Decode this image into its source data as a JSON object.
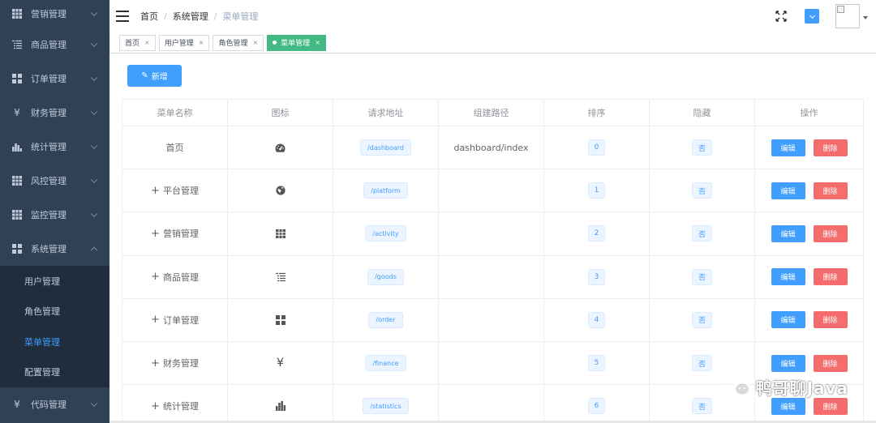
{
  "sidebar": {
    "items": [
      {
        "label": "营销管理",
        "icon": "grid-icon"
      },
      {
        "label": "商品管理",
        "icon": "list-icon"
      },
      {
        "label": "订单管理",
        "icon": "blocks-icon"
      },
      {
        "label": "财务管理",
        "icon": "yen-icon"
      },
      {
        "label": "统计管理",
        "icon": "bar-chart-icon"
      },
      {
        "label": "风控管理",
        "icon": "grid-icon"
      },
      {
        "label": "监控管理",
        "icon": "grid-icon"
      },
      {
        "label": "系统管理",
        "icon": "blocks-icon"
      }
    ],
    "submenu": [
      {
        "label": "用户管理"
      },
      {
        "label": "角色管理"
      },
      {
        "label": "菜单管理"
      },
      {
        "label": "配置管理"
      }
    ],
    "last_item": {
      "label": "代码管理",
      "icon": "yen-icon"
    }
  },
  "navbar": {
    "breadcrumb": [
      "首页",
      "系统管理",
      "菜单管理"
    ]
  },
  "tags": [
    {
      "label": "首页"
    },
    {
      "label": "用户管理"
    },
    {
      "label": "角色管理"
    },
    {
      "label": "菜单管理"
    }
  ],
  "toolbar": {
    "add_label": "新增"
  },
  "table": {
    "headers": [
      "菜单名称",
      "图标",
      "请求地址",
      "组建路径",
      "排序",
      "隐藏",
      "操作"
    ],
    "edit_label": "编辑",
    "delete_label": "删除",
    "rows": [
      {
        "name": "首页",
        "icon": "dashboard-icon",
        "path": "/dashboard",
        "component": "dashboard/index",
        "order": "0",
        "hidden": "否"
      },
      {
        "name": "平台管理",
        "icon": "globe-icon",
        "path": "/platform",
        "component": "",
        "order": "1",
        "hidden": "否"
      },
      {
        "name": "营销管理",
        "icon": "grid-icon",
        "path": "/activity",
        "component": "",
        "order": "2",
        "hidden": "否"
      },
      {
        "name": "商品管理",
        "icon": "list-icon",
        "path": "/goods",
        "component": "",
        "order": "3",
        "hidden": "否"
      },
      {
        "name": "订单管理",
        "icon": "blocks-icon",
        "path": "/order",
        "component": "",
        "order": "4",
        "hidden": "否"
      },
      {
        "name": "财务管理",
        "icon": "yen-icon",
        "path": "/finance",
        "component": "",
        "order": "5",
        "hidden": "否"
      },
      {
        "name": "统计管理",
        "icon": "bar-chart-icon",
        "path": "/statistics",
        "component": "",
        "order": "6",
        "hidden": "否"
      }
    ]
  },
  "watermark": {
    "text": "鸭哥聊Java"
  },
  "colors": {
    "sidebar_bg": "#304156",
    "submenu_bg": "#1f2d3d",
    "primary": "#409eff",
    "danger": "#f56c6c",
    "tag_active": "#42b983"
  }
}
